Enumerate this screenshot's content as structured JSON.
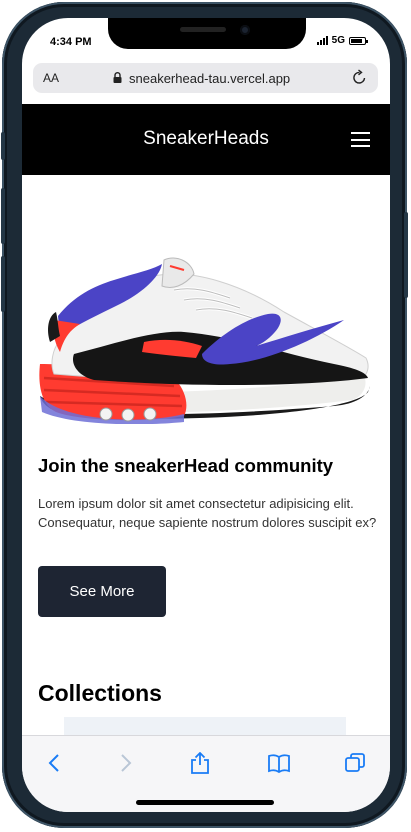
{
  "status_bar": {
    "time": "4:34 PM",
    "network": "5G"
  },
  "browser": {
    "text_size_label": "AA",
    "url": "sneakerhead-tau.vercel.app"
  },
  "navbar": {
    "brand": "SneakerHeads"
  },
  "hero": {
    "headline": "Join the sneakerHead community",
    "body": "Lorem ipsum dolor sit amet consectetur adipisicing elit. Consequatur, neque sapiente nostrum dolores suscipit ex?",
    "button_label": "See More"
  },
  "collections": {
    "title": "Collections"
  },
  "colors": {
    "navbar_bg": "#000000",
    "button_bg": "#1e2533",
    "shoe_accent_red": "#ff3b30",
    "shoe_accent_blue": "#4b44c6"
  },
  "icons": [
    "back-icon",
    "forward-icon",
    "share-icon",
    "bookmarks-icon",
    "tabs-icon",
    "lock-icon",
    "reload-icon",
    "hamburger-menu-icon"
  ]
}
